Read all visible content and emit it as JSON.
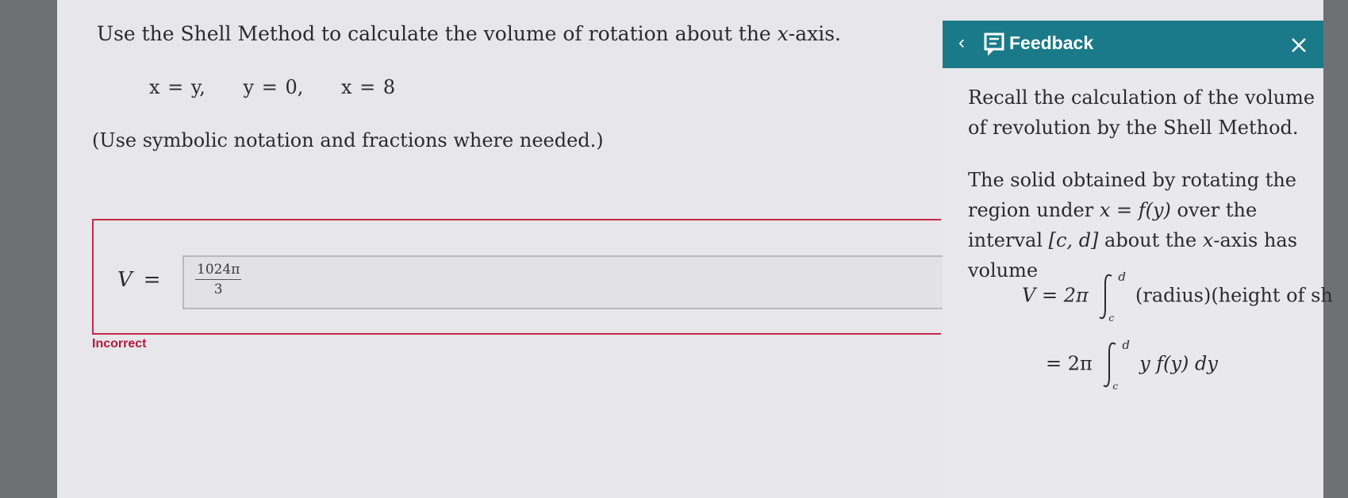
{
  "question": {
    "prefix": "Use the Shell Method to calculate the volume of rotation about the ",
    "var": "x",
    "suffix": "-axis."
  },
  "equations": [
    "x = y,",
    "y = 0,",
    "x = 8"
  ],
  "hint": "(Use symbolic notation and fractions where needed.)",
  "answer": {
    "label": "V",
    "equals": "=",
    "numerator": "1024π",
    "denominator": "3",
    "status": "Incorrect"
  },
  "feedback": {
    "back_icon": "chevron-left-icon",
    "title": "Feedback",
    "close_icon": "close-icon",
    "p1": "Recall the calculation of the volume of revolution by the Shell Method.",
    "p2a": "The solid obtained by rotating the region under ",
    "p2b": "x = f(y)",
    "p2c": " over the interval ",
    "p2d": "[c, d]",
    "p2e": " about the ",
    "p2f": "x",
    "p2g": "-axis has volume",
    "f1_lhs": "V = 2π",
    "f1_rhs": "(radius)(height of sh",
    "f2_lhs": "= 2π",
    "f2_rhs": "y f(y) dy",
    "upper": "d",
    "lower": "c",
    "accent": "#1b7a8a"
  }
}
